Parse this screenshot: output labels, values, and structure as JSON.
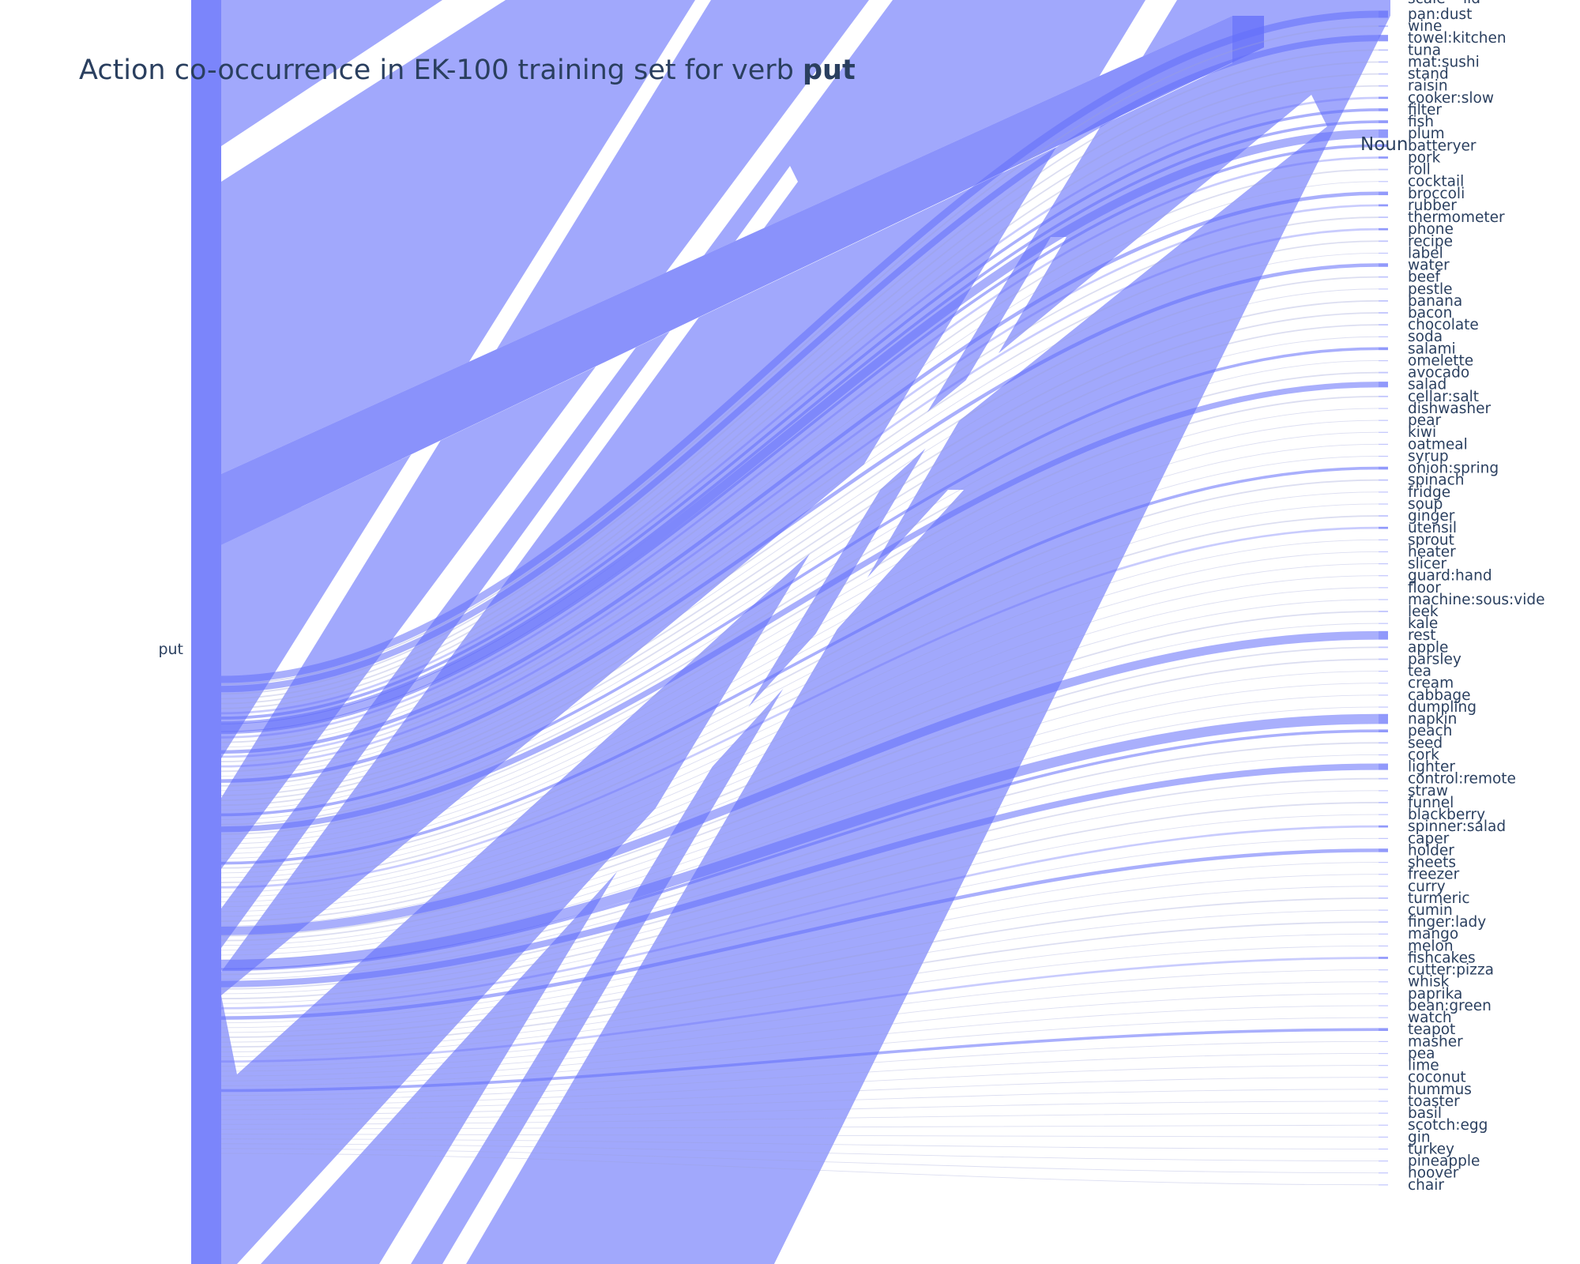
{
  "chart_data": {
    "type": "parallel-categories",
    "title": "Action co-occurrence in EK-100 training set for verb ",
    "title_bold": "put",
    "source_category": "put",
    "target_dimension_label": "Noun",
    "link_color": "#636efa",
    "clipped_node_labels": [
      "scale",
      "lid"
    ],
    "nouns": [
      {
        "name": "pan:dust",
        "weight": 10
      },
      {
        "name": "wine",
        "weight": 2
      },
      {
        "name": "towel:kitchen",
        "weight": 9
      },
      {
        "name": "tuna",
        "weight": 2
      },
      {
        "name": "mat:sushi",
        "weight": 2
      },
      {
        "name": "stand",
        "weight": 2
      },
      {
        "name": "raisin",
        "weight": 2
      },
      {
        "name": "cooker:slow",
        "weight": 3
      },
      {
        "name": "filter",
        "weight": 4
      },
      {
        "name": "fish",
        "weight": 4
      },
      {
        "name": "plum",
        "weight": 12
      },
      {
        "name": "batteryer",
        "weight": 4
      },
      {
        "name": "pork",
        "weight": 3
      },
      {
        "name": "roll",
        "weight": 2
      },
      {
        "name": "cocktail",
        "weight": 1
      },
      {
        "name": "broccoli",
        "weight": 5
      },
      {
        "name": "rubber",
        "weight": 3
      },
      {
        "name": "thermometer",
        "weight": 2
      },
      {
        "name": "phone",
        "weight": 3
      },
      {
        "name": "recipe",
        "weight": 2
      },
      {
        "name": "label",
        "weight": 1
      },
      {
        "name": "water",
        "weight": 5
      },
      {
        "name": "beef",
        "weight": 2
      },
      {
        "name": "pestle",
        "weight": 1
      },
      {
        "name": "banana",
        "weight": 2
      },
      {
        "name": "bacon",
        "weight": 2
      },
      {
        "name": "chocolate",
        "weight": 2
      },
      {
        "name": "soda",
        "weight": 1
      },
      {
        "name": "salami",
        "weight": 4
      },
      {
        "name": "omelette",
        "weight": 1
      },
      {
        "name": "avocado",
        "weight": 2
      },
      {
        "name": "salad",
        "weight": 8
      },
      {
        "name": "cellar:salt",
        "weight": 2
      },
      {
        "name": "dishwasher",
        "weight": 1
      },
      {
        "name": "pear",
        "weight": 1
      },
      {
        "name": "kiwi",
        "weight": 1
      },
      {
        "name": "oatmeal",
        "weight": 1
      },
      {
        "name": "syrup",
        "weight": 1
      },
      {
        "name": "onion:spring",
        "weight": 4
      },
      {
        "name": "spinach",
        "weight": 2
      },
      {
        "name": "fridge",
        "weight": 1
      },
      {
        "name": "soup",
        "weight": 1
      },
      {
        "name": "ginger",
        "weight": 2
      },
      {
        "name": "utensil",
        "weight": 3
      },
      {
        "name": "sprout",
        "weight": 1
      },
      {
        "name": "heater",
        "weight": 1
      },
      {
        "name": "slicer",
        "weight": 1
      },
      {
        "name": "guard:hand",
        "weight": 1
      },
      {
        "name": "floor",
        "weight": 1
      },
      {
        "name": "machine:sous:vide",
        "weight": 1
      },
      {
        "name": "leek",
        "weight": 2
      },
      {
        "name": "kale",
        "weight": 1
      },
      {
        "name": "rest",
        "weight": 12
      },
      {
        "name": "apple",
        "weight": 2
      },
      {
        "name": "parsley",
        "weight": 2
      },
      {
        "name": "tea",
        "weight": 1
      },
      {
        "name": "cream",
        "weight": 1
      },
      {
        "name": "cabbage",
        "weight": 1
      },
      {
        "name": "dumpling",
        "weight": 1
      },
      {
        "name": "napkin",
        "weight": 14
      },
      {
        "name": "peach",
        "weight": 4
      },
      {
        "name": "seed",
        "weight": 2
      },
      {
        "name": "cork",
        "weight": 1
      },
      {
        "name": "lighter",
        "weight": 9
      },
      {
        "name": "control:remote",
        "weight": 2
      },
      {
        "name": "straw",
        "weight": 1
      },
      {
        "name": "funnel",
        "weight": 2
      },
      {
        "name": "blackberry",
        "weight": 1
      },
      {
        "name": "spinner:salad",
        "weight": 3
      },
      {
        "name": "caper",
        "weight": 1
      },
      {
        "name": "holder",
        "weight": 5
      },
      {
        "name": "sheets",
        "weight": 1
      },
      {
        "name": "freezer",
        "weight": 1
      },
      {
        "name": "curry",
        "weight": 1
      },
      {
        "name": "turmeric",
        "weight": 2
      },
      {
        "name": "cumin",
        "weight": 1
      },
      {
        "name": "finger:lady",
        "weight": 2
      },
      {
        "name": "mango",
        "weight": 1
      },
      {
        "name": "melon",
        "weight": 1
      },
      {
        "name": "fishcakes",
        "weight": 3
      },
      {
        "name": "cutter:pizza",
        "weight": 1
      },
      {
        "name": "whisk",
        "weight": 1
      },
      {
        "name": "paprika",
        "weight": 1
      },
      {
        "name": "bean:green",
        "weight": 1
      },
      {
        "name": "watch",
        "weight": 1
      },
      {
        "name": "teapot",
        "weight": 4
      },
      {
        "name": "masher",
        "weight": 1
      },
      {
        "name": "pea",
        "weight": 1
      },
      {
        "name": "lime",
        "weight": 1
      },
      {
        "name": "coconut",
        "weight": 1
      },
      {
        "name": "hummus",
        "weight": 1
      },
      {
        "name": "toaster",
        "weight": 1
      },
      {
        "name": "basil",
        "weight": 1
      },
      {
        "name": "scotch:egg",
        "weight": 1
      },
      {
        "name": "gin",
        "weight": 1
      },
      {
        "name": "turkey",
        "weight": 1
      },
      {
        "name": "pineapple",
        "weight": 1
      },
      {
        "name": "hoover",
        "weight": 1
      },
      {
        "name": "chair",
        "weight": 1
      }
    ]
  }
}
